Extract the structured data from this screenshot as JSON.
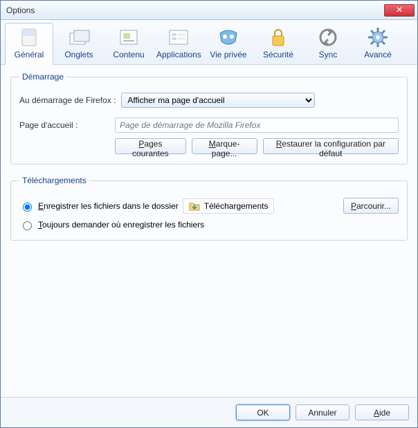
{
  "window": {
    "title": "Options"
  },
  "toolbar": {
    "items": [
      {
        "label": "Général"
      },
      {
        "label": "Onglets"
      },
      {
        "label": "Contenu"
      },
      {
        "label": "Applications"
      },
      {
        "label": "Vie privée"
      },
      {
        "label": "Sécurité"
      },
      {
        "label": "Sync"
      },
      {
        "label": "Avancé"
      }
    ]
  },
  "startup": {
    "legend": "Démarrage",
    "startup_label": "Au démarrage de Firefox :",
    "startup_value": "Afficher ma page d'accueil",
    "homepage_label": "Page d'accueil :",
    "homepage_placeholder": "Page de démarrage de Mozilla Firefox",
    "btn_current": "Pages courantes",
    "btn_bookmark": "Marque-page...",
    "btn_restore": "Restaurer la configuration par défaut"
  },
  "downloads": {
    "legend": "Téléchargements",
    "radio_save": "Enregistrer les fichiers dans le dossier",
    "folder_name": "Téléchargements",
    "btn_browse": "Parcourir...",
    "radio_ask": "Toujours demander où enregistrer les fichiers"
  },
  "footer": {
    "ok": "OK",
    "cancel": "Annuler",
    "help": "Aide"
  }
}
